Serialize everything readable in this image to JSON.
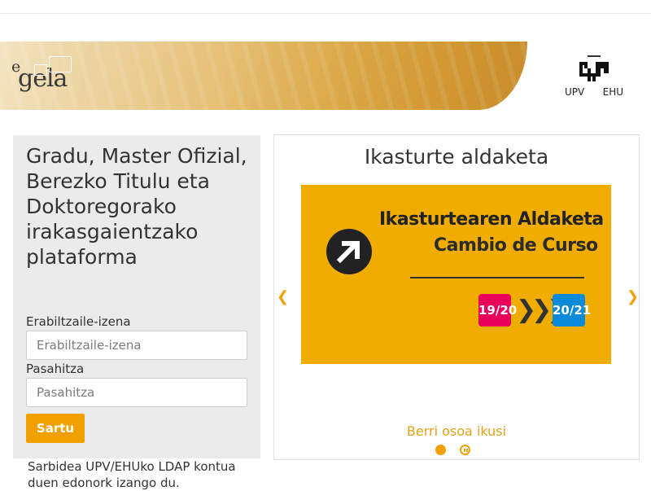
{
  "header": {
    "logo": {
      "prefix": "e",
      "name": "gela"
    },
    "university": {
      "labels": [
        "UPV",
        "EHU"
      ]
    }
  },
  "login": {
    "heading": "Gradu, Master Ofizial, Berezko Titulu eta Doktoregorako irakasgaientzako plataforma",
    "username_label": "Erabiltzaile-izena",
    "username_placeholder": "Erabiltzaile-izena",
    "username_value": "",
    "password_label": "Pasahitza",
    "password_placeholder": "Pasahitza",
    "password_value": "",
    "submit_label": "Sartu",
    "note": "Sarbidea UPV/EHUko LDAP kontua duen edonork izango du."
  },
  "carousel": {
    "title": "Ikasturte aldaketa",
    "slide": {
      "line1": "Ikasturtearen Aldaketa",
      "line2": "Cambio de Curso",
      "from": "19/20",
      "to": "20/21",
      "arrows": "❯❯❯"
    },
    "prev_icon": "chevron-left-icon",
    "next_icon": "chevron-right-icon",
    "more_link": "Berri osoa ikusi",
    "active_index": 0,
    "accent_color": "#f0a000"
  }
}
